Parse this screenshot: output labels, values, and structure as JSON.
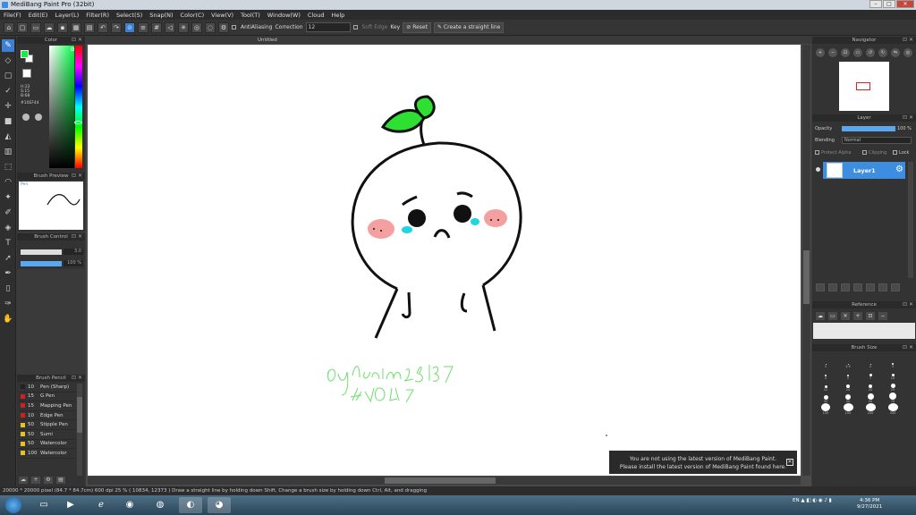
{
  "window": {
    "title": "MediBang Paint Pro (32bit)"
  },
  "menu": [
    "File(F)",
    "Edit(E)",
    "Layer(L)",
    "Filter(R)",
    "Select(S)",
    "Snap(N)",
    "Color(C)",
    "View(V)",
    "Tool(T)",
    "Window(W)",
    "Cloud",
    "Help"
  ],
  "toolbar": {
    "antialiasing": "AntiAliasing",
    "correction_label": "Correction",
    "correction_value": "12",
    "soft_edge": "Soft Edge",
    "key_label": "Key",
    "reset_label": "Reset",
    "straight_line": "Create a straight line"
  },
  "color_panel": {
    "title": "Color",
    "fg_color": "#10ef44",
    "hsv": [
      "H:22",
      "S:15",
      "B:68"
    ],
    "hex": "#10EF44"
  },
  "brush_preview": {
    "title": "Brush Preview",
    "label": "Pen"
  },
  "brush_control": {
    "title": "Brush Control",
    "size_value": "3.0",
    "opacity_value": "100 %"
  },
  "brush_panel": {
    "title": "Brush Pencil",
    "items": [
      {
        "size": "10",
        "name": "Pen (Sharp)",
        "color": "#222222"
      },
      {
        "size": "15",
        "name": "G Pen",
        "color": "#d02020"
      },
      {
        "size": "15",
        "name": "Mapping Pen",
        "color": "#d02020"
      },
      {
        "size": "10",
        "name": "Edge Pen",
        "color": "#d02020"
      },
      {
        "size": "50",
        "name": "Stipple Pen",
        "color": "#e8c020"
      },
      {
        "size": "50",
        "name": "Sumi",
        "color": "#e8c020"
      },
      {
        "size": "50",
        "name": "Watercolor",
        "color": "#e8c020"
      },
      {
        "size": "100",
        "name": "Watercolor",
        "color": "#e8c020"
      }
    ]
  },
  "document": {
    "title": "Untitled"
  },
  "notice": {
    "line1": "You are not using the latest version of MediBang Paint.",
    "line2": "Please install the latest version of MediBang Paint found here."
  },
  "navigator": {
    "title": "Navigator"
  },
  "layer_panel": {
    "title": "Layer",
    "opacity_label": "Opacity",
    "opacity_value": "100 %",
    "blending_label": "Blending",
    "blending_value": "Normal",
    "protect_alpha": "Protect Alpha",
    "clipping": "Clipping",
    "lock": "Lock",
    "layer_name": "Layer1"
  },
  "reference": {
    "title": "Reference"
  },
  "brush_size": {
    "title": "Brush Size",
    "sizes": [
      "1",
      "1.5",
      "2",
      "3",
      "4",
      "5",
      "7",
      "10",
      "12",
      "15",
      "20",
      "25",
      "30",
      "40",
      "50",
      "70",
      "100",
      "150",
      "200",
      "300"
    ]
  },
  "status": {
    "text": "20000 * 20000 pixel  (84.7 * 84.7cm)  600 dpi  25 %  ( 10834, 12373 )  Draw a straight line by holding down Shift, Change a brush size by holding down Ctrl, Alt, and dragging"
  },
  "taskbar": {
    "lang": "EN",
    "time": "4:36 PM",
    "date": "9/27/2021"
  }
}
